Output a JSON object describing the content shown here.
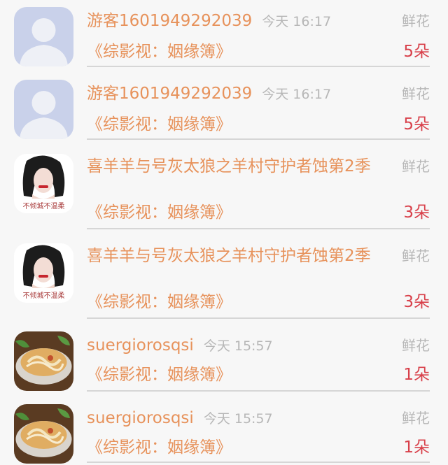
{
  "rows": [
    {
      "user": "游客1601949292039",
      "time": "今天 16:17",
      "flower_label": "鲜花",
      "title": "《综影视：姻缘簿》",
      "count": "5朵",
      "avatar": "default-person-icon"
    },
    {
      "user": "游客1601949292039",
      "time": "今天 16:17",
      "flower_label": "鲜花",
      "title": "《综影视：姻缘簿》",
      "count": "5朵",
      "avatar": "default-person-icon"
    },
    {
      "user": "喜羊羊与号灰太狼之羊村守护者蚀第2季",
      "time": "",
      "flower_label": "鲜花",
      "title": "《综影视：姻缘簿》",
      "count": "3朵",
      "avatar": "woman-photo-avatar",
      "avatar_caption": "不倾城不温柔"
    },
    {
      "user": "喜羊羊与号灰太狼之羊村守护者蚀第2季",
      "time": "",
      "flower_label": "鲜花",
      "title": "《综影视：姻缘簿》",
      "count": "3朵",
      "avatar": "woman-photo-avatar",
      "avatar_caption": "不倾城不温柔"
    },
    {
      "user": "suergiorosqsi",
      "time": "今天 15:57",
      "flower_label": "鲜花",
      "title": "《综影视：姻缘簿》",
      "count": "1朵",
      "avatar": "food-bowl-avatar"
    },
    {
      "user": "suergiorosqsi",
      "time": "今天 15:57",
      "flower_label": "鲜花",
      "title": "《综影视：姻缘簿》",
      "count": "1朵",
      "avatar": "food-bowl-avatar"
    }
  ],
  "colors": {
    "name": "#e7925b",
    "meta": "#b7b7b7",
    "count": "#d8404a",
    "divider": "#d6d6d6",
    "background": "#f7f7f7"
  }
}
